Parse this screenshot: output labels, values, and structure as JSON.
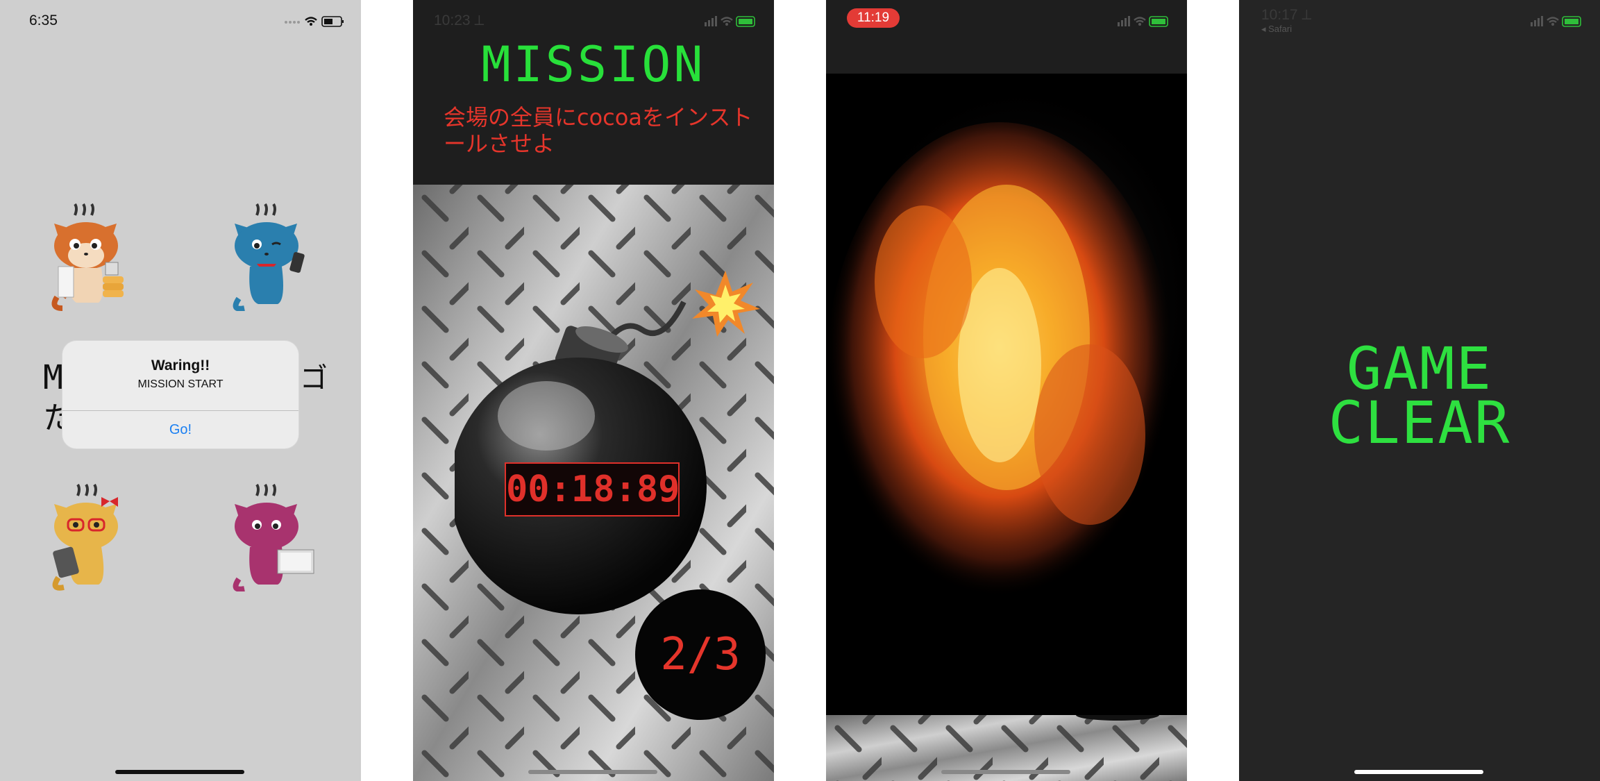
{
  "screens": [
    {
      "time": "6:35",
      "alert": {
        "title": "Waring!!",
        "message": "MISSION START",
        "button": "Go!"
      },
      "background_title": {
        "line1": "M",
        "line2": "た",
        "trail": "ゴ"
      },
      "characters": [
        "orange-cat",
        "blue-cat",
        "yellow-cat",
        "magenta-cat"
      ]
    },
    {
      "time": "10:23 ⟂",
      "title": "MISSION",
      "task": "会場の全員にcocoaをインストールさせよ",
      "timer": "00:18:89",
      "counter": "2/3"
    },
    {
      "time": "11:19"
    },
    {
      "time": "10:17 ⟂",
      "back_label": "◂ Safari",
      "result_line1": "GAME",
      "result_line2": "CLEAR"
    }
  ],
  "colors": {
    "accent_green": "#28e03a",
    "alert_red": "#e5352b",
    "link_blue": "#1a7ff2"
  }
}
